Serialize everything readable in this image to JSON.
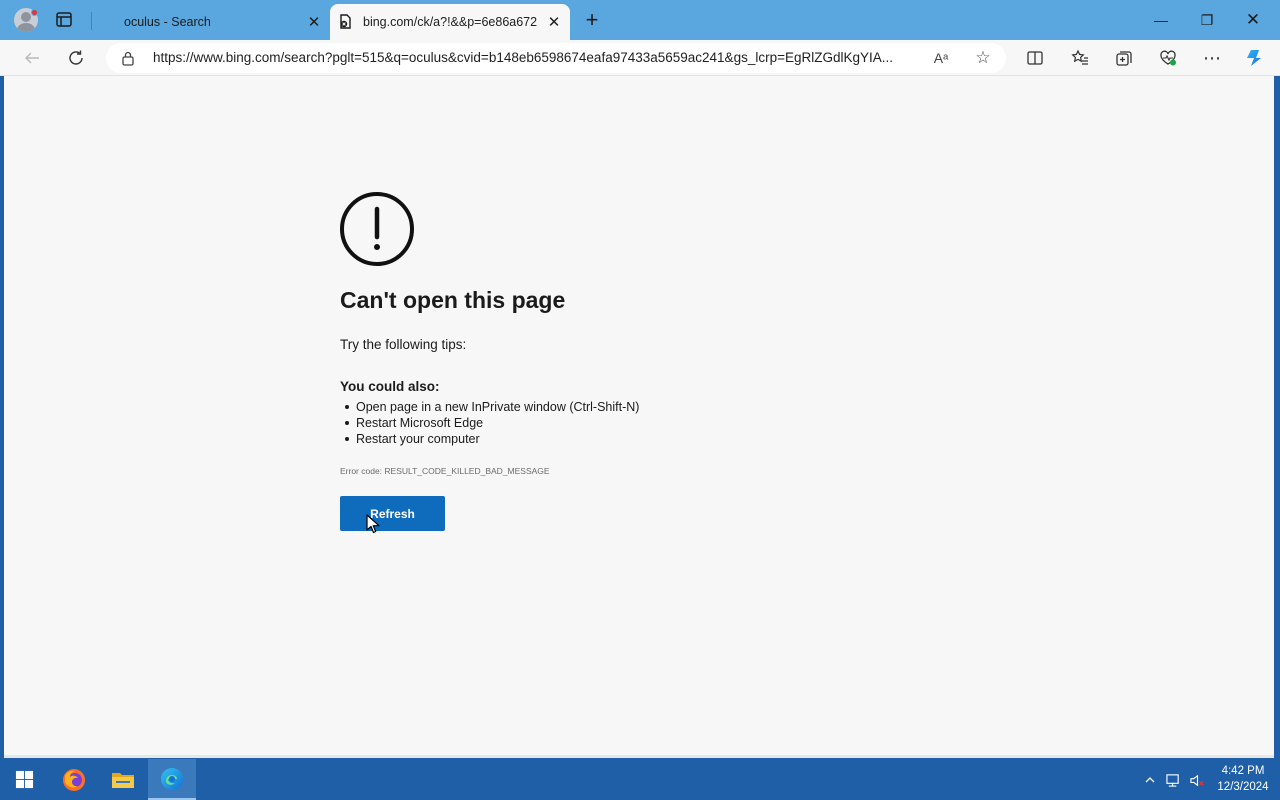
{
  "browser": {
    "tabs": [
      {
        "title": "oculus - Search",
        "active": false
      },
      {
        "title": "bing.com/ck/a?!&&p=6e86a672",
        "active": true
      }
    ],
    "address": {
      "url": "https://www.bing.com/search?pglt=515&q=oculus&cvid=b148eb6598674eafa97433a5659ac241&gs_lcrp=EgRlZGdlKgYIA..."
    },
    "read_aloud": "Aᵃ",
    "window_controls": {
      "minimize": "—",
      "maximize": "❐",
      "close": "✕"
    }
  },
  "error_page": {
    "title": "Can't open this page",
    "tips_intro": "Try the following tips:",
    "also_heading": "You could also:",
    "suggestions": [
      "Open page in a new InPrivate window (Ctrl-Shift-N)",
      "Restart Microsoft Edge",
      "Restart your computer"
    ],
    "error_code": "Error code: RESULT_CODE_KILLED_BAD_MESSAGE",
    "refresh_label": "Refresh"
  },
  "taskbar": {
    "time": "4:42 PM",
    "date": "12/3/2024"
  },
  "colors": {
    "titlebar": "#5aa7df",
    "accent_button": "#0f6cbd",
    "taskbar": "#1f5fa8"
  }
}
